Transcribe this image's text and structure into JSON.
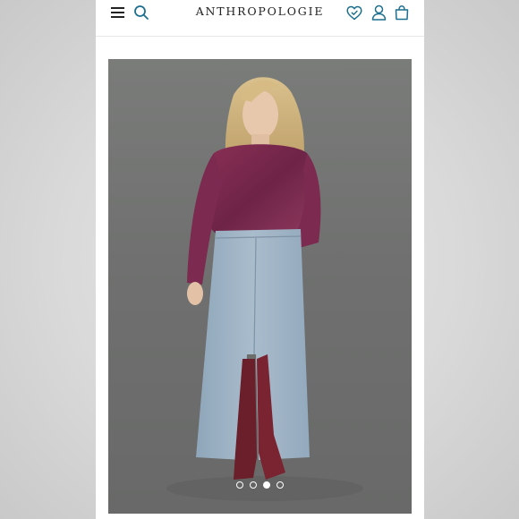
{
  "header": {
    "brand": "ANTHROPOLOGIE",
    "icons": {
      "menu": "hamburger-menu-icon",
      "search": "search-icon",
      "wishlist": "heart-icon",
      "account": "user-icon",
      "bag": "shopping-bag-icon"
    },
    "accent_color": "#1c6f8f"
  },
  "gallery": {
    "image_count": 4,
    "active_index": 2
  }
}
